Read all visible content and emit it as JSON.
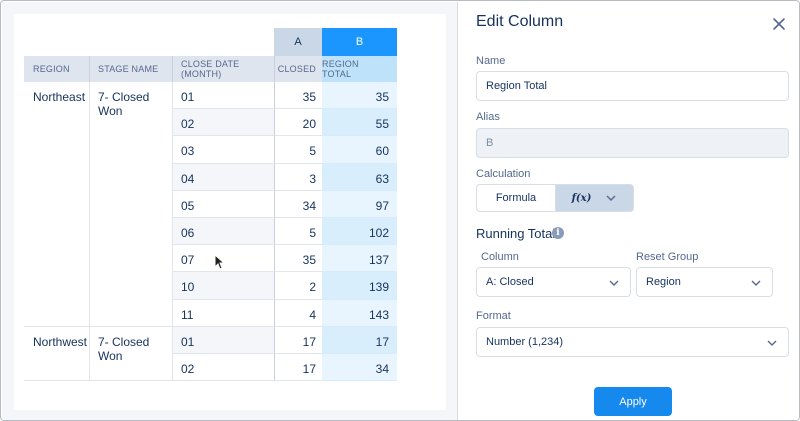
{
  "table": {
    "col_letters": {
      "a": "A",
      "b": "B"
    },
    "headers": {
      "region": "REGION",
      "stage": "STAGE NAME",
      "close_date": "CLOSE DATE (MONTH)",
      "closed": "CLOSED",
      "region_total": "REGION TOTAL"
    },
    "groups": [
      {
        "region": "Northeast",
        "stage": "7- Closed Won"
      },
      {
        "region": "Northwest",
        "stage": "7- Closed Won"
      }
    ],
    "rows": [
      {
        "month": "01",
        "closed": "35",
        "total": "35"
      },
      {
        "month": "02",
        "closed": "20",
        "total": "55"
      },
      {
        "month": "03",
        "closed": "5",
        "total": "60"
      },
      {
        "month": "04",
        "closed": "3",
        "total": "63"
      },
      {
        "month": "05",
        "closed": "34",
        "total": "97"
      },
      {
        "month": "06",
        "closed": "5",
        "total": "102"
      },
      {
        "month": "07",
        "closed": "35",
        "total": "137"
      },
      {
        "month": "10",
        "closed": "2",
        "total": "139"
      },
      {
        "month": "11",
        "closed": "4",
        "total": "143"
      },
      {
        "month": "01",
        "closed": "17",
        "total": "17"
      },
      {
        "month": "02",
        "closed": "17",
        "total": "34"
      }
    ]
  },
  "panel": {
    "title": "Edit Column",
    "name_label": "Name",
    "name_value": "Region Total",
    "alias_label": "Alias",
    "alias_value": "B",
    "calculation_label": "Calculation",
    "formula_label": "Formula",
    "fx_label": "f(x)",
    "running_total_title": "Running Total",
    "column_label": "Column",
    "column_value": "A: Closed",
    "reset_group_label": "Reset Group",
    "reset_group_value": "Region",
    "format_label": "Format",
    "format_value": "Number (1,234)",
    "apply_label": "Apply"
  },
  "colors": {
    "accent": "#1589ee",
    "col_b_header": "#0d9dda",
    "col_a_header": "#c9d7e6"
  }
}
